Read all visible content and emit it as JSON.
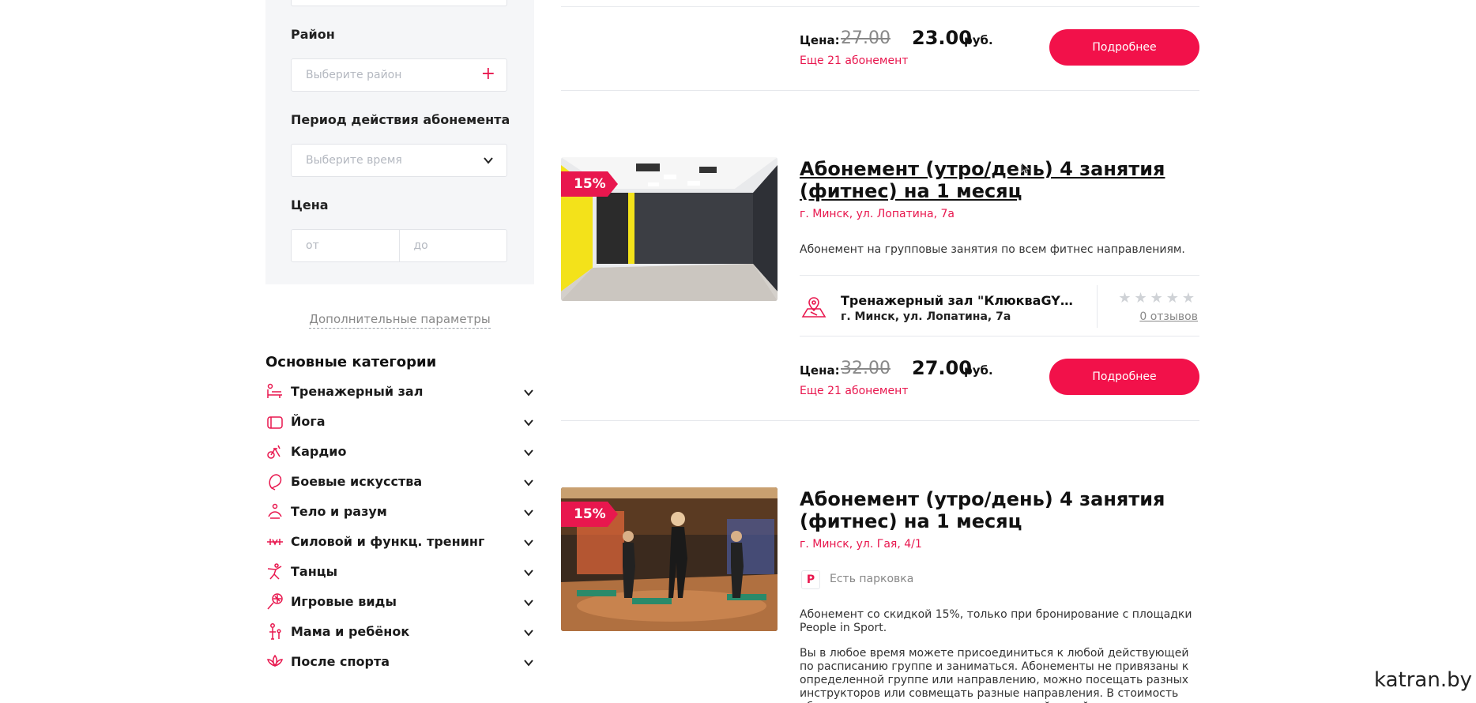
{
  "filters": {
    "district_label": "Район",
    "district_placeholder": "Выберите район",
    "period_label": "Период действия абонемента",
    "period_placeholder": "Выберите время",
    "price_label": "Цена",
    "price_from_placeholder": "от",
    "price_to_placeholder": "до",
    "more_params": "Дополнительные параметры"
  },
  "categories": {
    "title": "Основные категории",
    "items": [
      {
        "label": "Тренажерный зал",
        "icon": "gym-bench-icon"
      },
      {
        "label": "Йога",
        "icon": "yoga-mat-icon"
      },
      {
        "label": "Кардио",
        "icon": "exercise-bike-icon"
      },
      {
        "label": "Боевые искусства",
        "icon": "boxing-glove-icon"
      },
      {
        "label": "Тело и разум",
        "icon": "meditation-icon"
      },
      {
        "label": "Силовой и функц. тренинг",
        "icon": "kettlebell-icon"
      },
      {
        "label": "Танцы",
        "icon": "dancer-icon"
      },
      {
        "label": "Игровые виды",
        "icon": "tennis-racket-icon"
      },
      {
        "label": "Мама и ребёнок",
        "icon": "mother-child-icon"
      },
      {
        "label": "После спорта",
        "icon": "lotus-icon"
      }
    ]
  },
  "listings": [
    {
      "price_label": "Цена:",
      "old_price": "27.00",
      "new_price": "23.00",
      "currency": "руб.",
      "more_subscriptions": "Еще 21 абонемент",
      "button": "Подробнее"
    },
    {
      "discount": "15%",
      "title": "Абонемент (утро/день) 4 занятия (фитнес) на 1 месяц",
      "address": "г. Минск, ул. Лопатина, 7а",
      "description": "Абонемент на групповые занятия по всем фитнес направлениям.",
      "club_name": "Тренажерный зал \"КлюкваGYM\" (ул...",
      "club_address": "г. Минск, ул. Лопатина, 7а",
      "stars": "★★★★★",
      "rating": 0,
      "reviews": "0 отзывов",
      "price_label": "Цена:",
      "old_price": "32.00",
      "new_price": "27.00",
      "currency": "руб.",
      "more_subscriptions": "Еще 21 абонемент",
      "button": "Подробнее"
    },
    {
      "discount": "15%",
      "title": "Абонемент (утро/день) 4 занятия (фитнес) на 1 месяц",
      "address": "г. Минск, ул. Гая, 4/1",
      "parking_badge": "P",
      "parking": "Есть парковка",
      "description_1": "Абонемент со скидкой 15%, только при бронирование с площадки People in Sport.",
      "description_2": "Вы в любое время можете присоединиться к любой действующей по расписанию группе и заниматься. Абонементы не привязаны к определенной группе или направлению, можно посещать разных инструкторов или совмещать разные направления. В стоимость абонемента входит пользование питьевой водой, индивидуальными..."
    }
  ],
  "watermark": "katran.by",
  "colors": {
    "accent": "#e8174e",
    "button": "#f2114a",
    "sidebar_bg": "#f5f6f8"
  }
}
